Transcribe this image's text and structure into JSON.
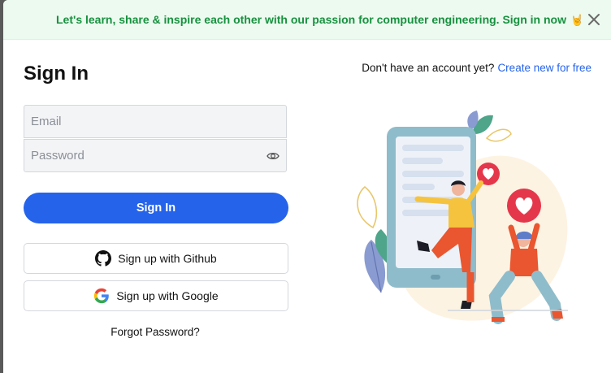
{
  "banner": {
    "text": "Let's learn, share & inspire each other with our passion for computer engineering. Sign in now",
    "emoji": "🤘"
  },
  "form": {
    "title": "Sign In",
    "signup_prompt": "Don't have an account yet?",
    "signup_link": "Create new for free",
    "email_placeholder": "Email",
    "password_placeholder": "Password",
    "submit_label": "Sign In",
    "github_label": "Sign up with Github",
    "google_label": "Sign up with Google",
    "forgot_label": "Forgot Password?"
  },
  "colors": {
    "accent": "#2563eb",
    "banner_bg": "#ecfaef",
    "banner_text": "#17913f"
  },
  "icons": {
    "close": "close-icon",
    "password_toggle": "eye-icon",
    "github": "github-icon",
    "google": "google-icon"
  }
}
